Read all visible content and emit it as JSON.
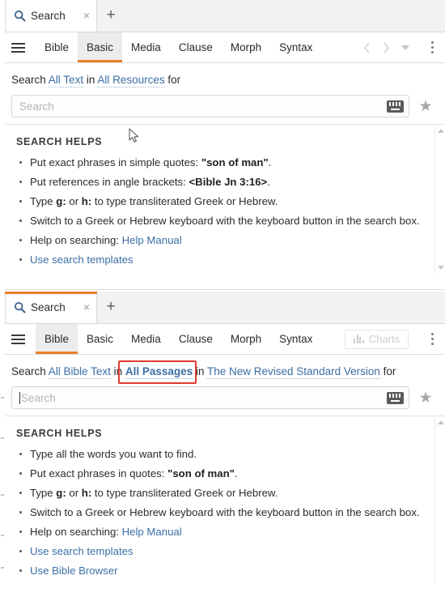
{
  "panels": [
    {
      "tab": {
        "title": "Search",
        "close_label": "×",
        "new_tab_label": "+",
        "icon": "search-icon"
      },
      "toolbar": {
        "menu_icon": "hamburger-icon",
        "tabs": [
          {
            "label": "Bible",
            "active": false
          },
          {
            "label": "Basic",
            "active": true
          },
          {
            "label": "Media",
            "active": false
          },
          {
            "label": "Clause",
            "active": false
          },
          {
            "label": "Morph",
            "active": false
          },
          {
            "label": "Syntax",
            "active": false
          }
        ],
        "back_icon": "chevron-left-icon",
        "forward_icon": "chevron-right-icon",
        "dropdown_icon": "chevron-down-icon",
        "overflow_icon": "kebab-menu-icon",
        "charts_button": null
      },
      "search": {
        "prefix": "Search",
        "scope_link": "All Text",
        "joiner1": "in",
        "resource_link": "All Resources",
        "joiner2": "",
        "version_link": "",
        "suffix": "for",
        "placeholder": "Search",
        "value": "",
        "keyboard_icon": "keyboard-icon",
        "favorite_icon": "star-icon",
        "highlighted": false,
        "caret_visible": false
      },
      "helps": {
        "title": "SEARCH HELPS",
        "items": [
          {
            "parts": [
              {
                "t": "Put exact phrases in simple quotes: ",
                "s": "plain"
              },
              {
                "t": "\"son of man\"",
                "s": "bold"
              },
              {
                "t": ".",
                "s": "plain"
              }
            ]
          },
          {
            "parts": [
              {
                "t": "Put references in angle brackets: ",
                "s": "plain"
              },
              {
                "t": "<Bible Jn 3:16>",
                "s": "bold"
              },
              {
                "t": ".",
                "s": "plain"
              }
            ]
          },
          {
            "parts": [
              {
                "t": "Type ",
                "s": "plain"
              },
              {
                "t": "g:",
                "s": "bold"
              },
              {
                "t": " or ",
                "s": "plain"
              },
              {
                "t": "h:",
                "s": "bold"
              },
              {
                "t": " to type transliterated Greek or Hebrew.",
                "s": "plain"
              }
            ]
          },
          {
            "parts": [
              {
                "t": "Switch to a Greek or Hebrew keyboard with the keyboard button in the search box.",
                "s": "plain"
              }
            ]
          },
          {
            "parts": [
              {
                "t": "Help on searching: ",
                "s": "plain"
              },
              {
                "t": "Help Manual",
                "s": "link"
              }
            ]
          },
          {
            "parts": [
              {
                "t": "Use search templates",
                "s": "link"
              }
            ]
          }
        ]
      }
    },
    {
      "tab": {
        "title": "Search",
        "close_label": "×",
        "new_tab_label": "+",
        "icon": "search-icon"
      },
      "toolbar": {
        "menu_icon": "hamburger-icon",
        "tabs": [
          {
            "label": "Bible",
            "active": true
          },
          {
            "label": "Basic",
            "active": false
          },
          {
            "label": "Media",
            "active": false
          },
          {
            "label": "Clause",
            "active": false
          },
          {
            "label": "Morph",
            "active": false
          },
          {
            "label": "Syntax",
            "active": false
          }
        ],
        "back_icon": "",
        "forward_icon": "",
        "dropdown_icon": "",
        "overflow_icon": "kebab-menu-icon",
        "charts_button": {
          "label": "Charts",
          "icon": "bar-chart-icon",
          "disabled": true
        }
      },
      "search": {
        "prefix": "Search",
        "scope_link": "All Bible Text",
        "joiner1": "in",
        "resource_link": "All Passages",
        "joiner2": "in",
        "version_link": "The New Revised Standard Version",
        "suffix": "for",
        "placeholder": "Search",
        "value": "",
        "keyboard_icon": "keyboard-icon",
        "favorite_icon": "star-icon",
        "highlighted": true,
        "highlight_color": "#e03a2f",
        "caret_visible": true
      },
      "helps": {
        "title": "SEARCH HELPS",
        "items": [
          {
            "parts": [
              {
                "t": "Type all the words you want to find.",
                "s": "plain"
              }
            ]
          },
          {
            "parts": [
              {
                "t": "Put exact phrases in quotes: ",
                "s": "plain"
              },
              {
                "t": "\"son of man\"",
                "s": "bold"
              },
              {
                "t": ".",
                "s": "plain"
              }
            ]
          },
          {
            "parts": [
              {
                "t": "Type ",
                "s": "plain"
              },
              {
                "t": "g:",
                "s": "bold"
              },
              {
                "t": " or ",
                "s": "plain"
              },
              {
                "t": "h:",
                "s": "bold"
              },
              {
                "t": " to type transliterated Greek or Hebrew.",
                "s": "plain"
              }
            ]
          },
          {
            "parts": [
              {
                "t": "Switch to a Greek or Hebrew keyboard with the keyboard button in the search box.",
                "s": "plain"
              }
            ]
          },
          {
            "parts": [
              {
                "t": "Help on searching: ",
                "s": "plain"
              },
              {
                "t": "Help Manual",
                "s": "link"
              }
            ]
          },
          {
            "parts": [
              {
                "t": "Use search templates",
                "s": "link"
              }
            ]
          },
          {
            "parts": [
              {
                "t": "Use Bible Browser",
                "s": "link"
              }
            ]
          }
        ]
      }
    }
  ],
  "colors": {
    "accent_orange": "#e8822a",
    "link_blue": "#3b6ea5",
    "highlight_red": "#e03a2f",
    "tabstrip_bg": "#f2f2f2",
    "active_tab_bg": "#ececec"
  }
}
